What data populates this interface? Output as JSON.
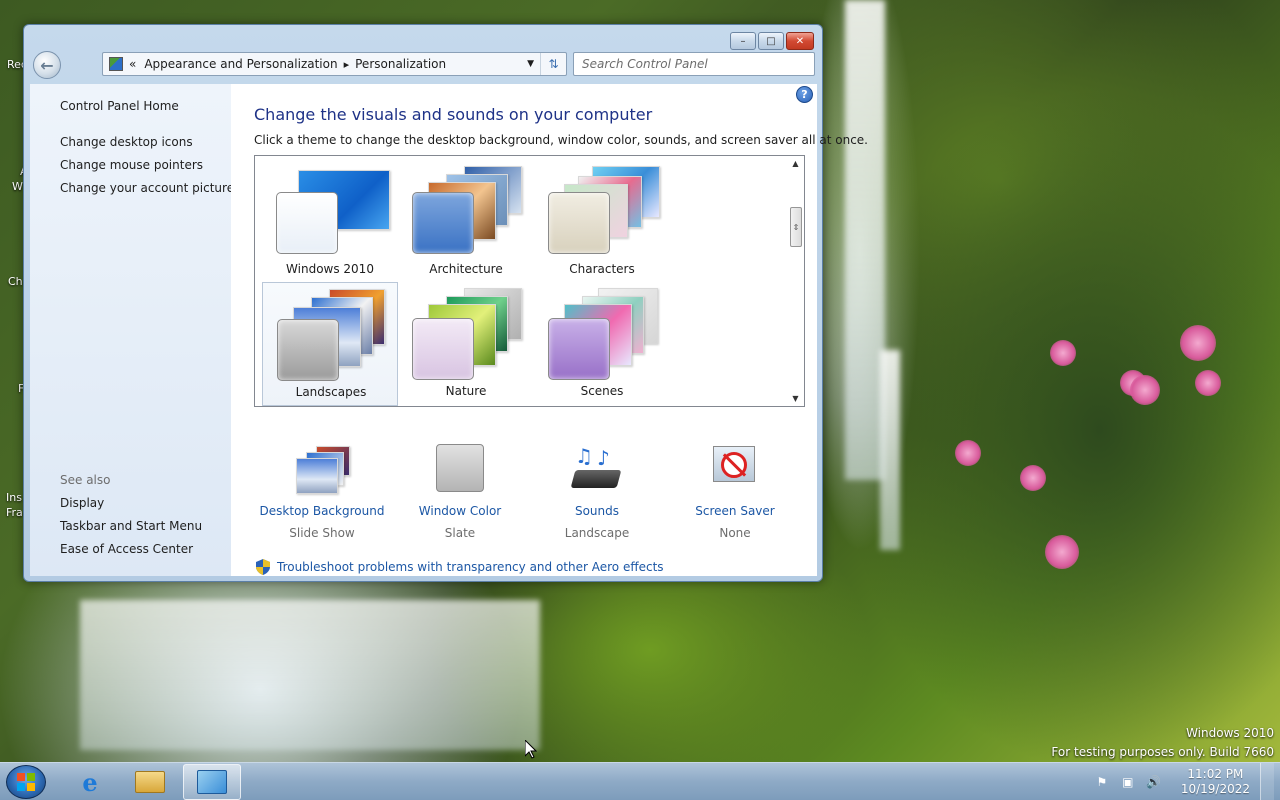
{
  "desktop": {
    "icon_labels": [
      "Rec",
      "A",
      "W",
      "Ch",
      "F",
      "Ins",
      "Fra"
    ],
    "watermark_line1": "Windows 2010",
    "watermark_line2": "For testing purposes only. Build 7660"
  },
  "window": {
    "breadcrumb": {
      "chevron": "«",
      "items": [
        "Appearance and Personalization",
        "Personalization"
      ],
      "separator": "▸"
    },
    "search": {
      "placeholder": "Search Control Panel"
    },
    "controls": {
      "minimize": "–",
      "maximize": "□",
      "close": "✕"
    }
  },
  "left_pane": {
    "home": "Control Panel Home",
    "tasks": [
      "Change desktop icons",
      "Change mouse pointers",
      "Change your account picture"
    ],
    "see_also_label": "See also",
    "see_also": [
      "Display",
      "Taskbar and Start Menu",
      "Ease of Access Center"
    ]
  },
  "main": {
    "title": "Change the visuals and sounds on your computer",
    "subtitle": "Click a theme to change the desktop background, window color, sounds, and screen saver all at once.",
    "themes": [
      "Windows 2010",
      "Architecture",
      "Characters",
      "Landscapes",
      "Nature",
      "Scenes"
    ],
    "selected_theme": "Landscapes",
    "settings": [
      {
        "link": "Desktop Background",
        "value": "Slide Show"
      },
      {
        "link": "Window Color",
        "value": "Slate"
      },
      {
        "link": "Sounds",
        "value": "Landscape"
      },
      {
        "link": "Screen Saver",
        "value": "None"
      }
    ],
    "troubleshoot": "Troubleshoot problems with transparency and other Aero effects"
  },
  "taskbar": {
    "time": "11:02 PM",
    "date": "10/19/2022"
  },
  "colors": {
    "link_blue": "#1c57a5",
    "heading_blue": "#1e3287",
    "taskbar": "#8eaac6"
  }
}
